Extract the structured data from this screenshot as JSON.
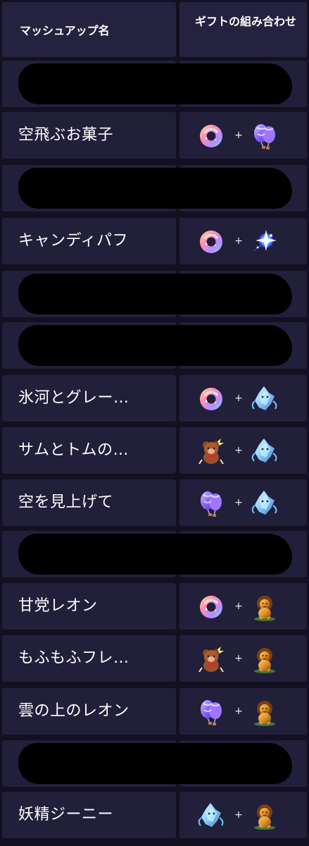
{
  "header": {
    "mashup_name_label": "マッシュアップ名",
    "gift_combo_label": "ギフトの組み合わせ"
  },
  "colors": {
    "background": "#121021",
    "cell": "#221f3b",
    "header_cell": "#25223f",
    "text": "#ffffff",
    "redaction": "#000000"
  },
  "rows": [
    {
      "redacted": true
    },
    {
      "name": "空飛ぶお菓子",
      "gift1": "donut-icon",
      "plus": "+",
      "gift2": "hot-air-balloon-icon"
    },
    {
      "redacted": true
    },
    {
      "name": "キャンディパフ",
      "gift1": "donut-icon",
      "plus": "+",
      "gift2": "sparkle-comet-icon"
    },
    {
      "redacted": true
    },
    {
      "redacted": true
    },
    {
      "name": "氷河とグレー…",
      "gift1": "donut-icon",
      "plus": "+",
      "gift2": "ice-crystal-creature-icon"
    },
    {
      "name": "サムとトムの…",
      "gift1": "teddy-bear-icon",
      "plus": "+",
      "gift2": "ice-crystal-creature-icon"
    },
    {
      "name": "空を見上げて",
      "gift1": "hot-air-balloon-icon",
      "plus": "+",
      "gift2": "ice-crystal-creature-icon"
    },
    {
      "redacted": true
    },
    {
      "name": "甘党レオン",
      "gift1": "donut-icon",
      "plus": "+",
      "gift2": "lion-icon"
    },
    {
      "name": "もふもふフレ…",
      "gift1": "teddy-bear-icon",
      "plus": "+",
      "gift2": "lion-icon"
    },
    {
      "name": "雲の上のレオン",
      "gift1": "hot-air-balloon-icon",
      "plus": "+",
      "gift2": "lion-icon"
    },
    {
      "redacted": true
    },
    {
      "name": "妖精ジーニー",
      "gift1": "ice-crystal-creature-icon",
      "plus": "+",
      "gift2": "lion-icon"
    }
  ]
}
